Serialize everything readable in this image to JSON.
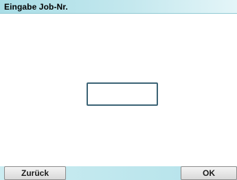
{
  "window": {
    "title": "Eingabe Job-Nr."
  },
  "job_input": {
    "value": "",
    "placeholder": ""
  },
  "buttons": {
    "back_label": "Zurück",
    "ok_label": "OK"
  },
  "colors": {
    "title_bar": "#c4e8ee",
    "bottom_bar": "#b3e2ea",
    "input_border": "#3a6274"
  }
}
